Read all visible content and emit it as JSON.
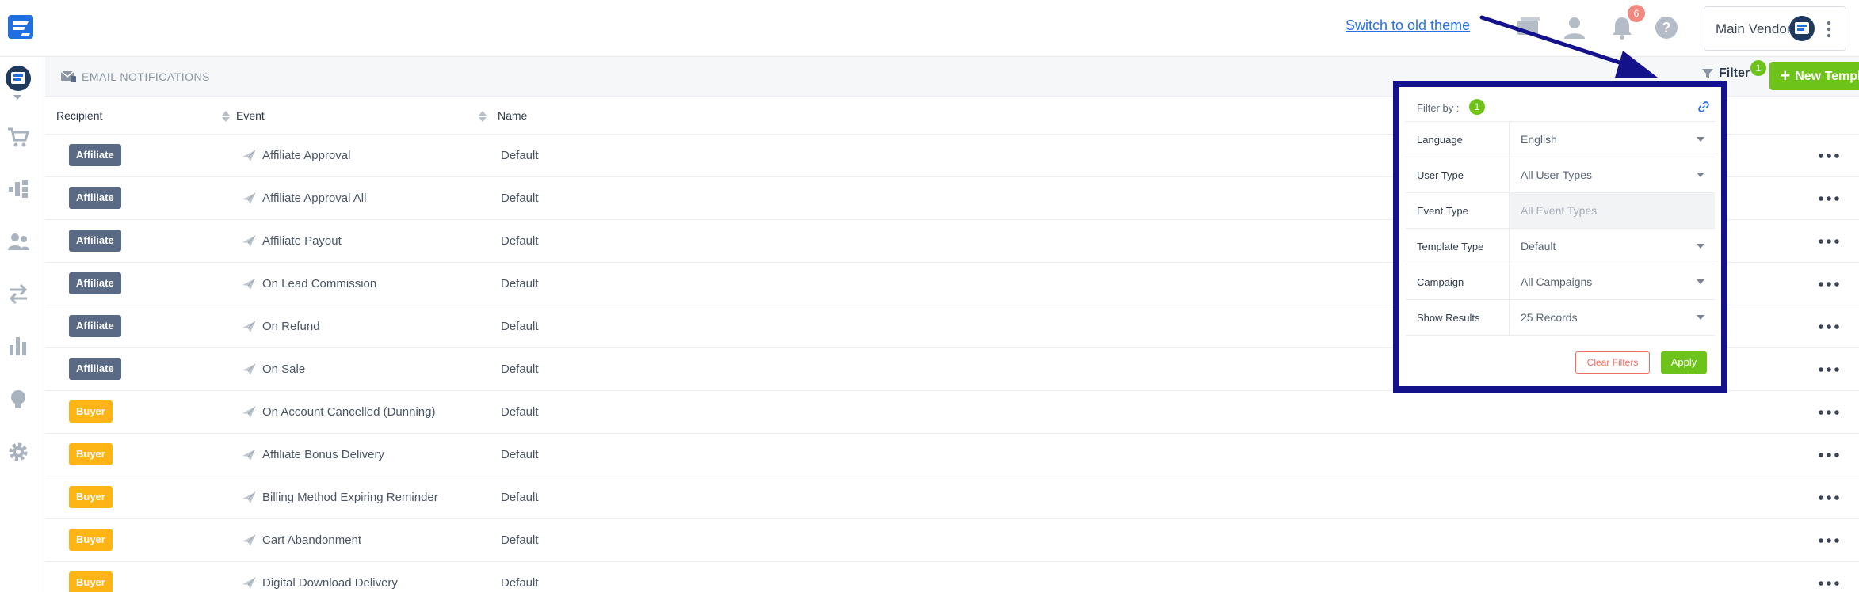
{
  "header": {
    "switch_theme_label": "Switch to old theme",
    "notification_count": "6",
    "vendor_name": "Main Vendor"
  },
  "section": {
    "title": "EMAIL NOTIFICATIONS",
    "filter_label": "Filter",
    "filter_count": "1",
    "new_template_label": "New Template"
  },
  "table": {
    "columns": [
      "Recipient",
      "Event",
      "Name"
    ],
    "rows": [
      {
        "recipient": "Affiliate",
        "type": "affiliate",
        "event": "Affiliate Approval",
        "name": "Default"
      },
      {
        "recipient": "Affiliate",
        "type": "affiliate",
        "event": "Affiliate Approval All",
        "name": "Default"
      },
      {
        "recipient": "Affiliate",
        "type": "affiliate",
        "event": "Affiliate Payout",
        "name": "Default"
      },
      {
        "recipient": "Affiliate",
        "type": "affiliate",
        "event": "On Lead Commission",
        "name": "Default"
      },
      {
        "recipient": "Affiliate",
        "type": "affiliate",
        "event": "On Refund",
        "name": "Default"
      },
      {
        "recipient": "Affiliate",
        "type": "affiliate",
        "event": "On Sale",
        "name": "Default"
      },
      {
        "recipient": "Buyer",
        "type": "buyer",
        "event": "On Account Cancelled (Dunning)",
        "name": "Default"
      },
      {
        "recipient": "Buyer",
        "type": "buyer",
        "event": "Affiliate Bonus Delivery",
        "name": "Default"
      },
      {
        "recipient": "Buyer",
        "type": "buyer",
        "event": "Billing Method Expiring Reminder",
        "name": "Default"
      },
      {
        "recipient": "Buyer",
        "type": "buyer",
        "event": "Cart Abandonment",
        "name": "Default"
      },
      {
        "recipient": "Buyer",
        "type": "buyer",
        "event": "Digital Download Delivery",
        "name": "Default"
      }
    ]
  },
  "filter_panel": {
    "title": "Filter by :",
    "count": "1",
    "fields": [
      {
        "label": "Language",
        "value": "English",
        "disabled": false
      },
      {
        "label": "User Type",
        "value": "All User Types",
        "disabled": false
      },
      {
        "label": "Event Type",
        "value": "All Event Types",
        "disabled": true
      },
      {
        "label": "Template Type",
        "value": "Default",
        "disabled": false
      },
      {
        "label": "Campaign",
        "value": "All Campaigns",
        "disabled": false
      },
      {
        "label": "Show Results",
        "value": "25 Records",
        "disabled": false
      }
    ],
    "clear_label": "Clear Filters",
    "apply_label": "Apply"
  },
  "colors": {
    "accent_green": "#6ec31b",
    "affiliate_badge": "#5a6a85",
    "buyer_badge": "#fdb515",
    "annotation_navy": "#14128a",
    "link_blue": "#2d6ee0"
  },
  "icons": {
    "logo": "brand-logo-icon",
    "messages": "message-icon",
    "user": "user-icon",
    "bell": "bell-icon",
    "help": "help-icon",
    "filter": "funnel-icon",
    "plus": "plus-icon",
    "event": "paper-plane-icon",
    "link": "link-icon"
  }
}
